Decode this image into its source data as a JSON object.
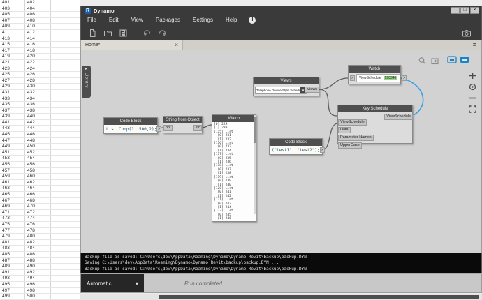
{
  "excel": {
    "rows": [
      [
        401,
        402
      ],
      [
        403,
        404
      ],
      [
        405,
        406
      ],
      [
        407,
        408
      ],
      [
        409,
        410
      ],
      [
        411,
        412
      ],
      [
        413,
        414
      ],
      [
        415,
        416
      ],
      [
        417,
        418
      ],
      [
        419,
        420
      ],
      [
        421,
        422
      ],
      [
        423,
        424
      ],
      [
        425,
        426
      ],
      [
        427,
        428
      ],
      [
        429,
        430
      ],
      [
        431,
        432
      ],
      [
        433,
        434
      ],
      [
        435,
        436
      ],
      [
        437,
        438
      ],
      [
        439,
        440
      ],
      [
        441,
        442
      ],
      [
        443,
        444
      ],
      [
        445,
        446
      ],
      [
        447,
        448
      ],
      [
        449,
        450
      ],
      [
        451,
        452
      ],
      [
        453,
        454
      ],
      [
        455,
        456
      ],
      [
        457,
        458
      ],
      [
        459,
        460
      ],
      [
        461,
        462
      ],
      [
        463,
        464
      ],
      [
        465,
        466
      ],
      [
        467,
        468
      ],
      [
        469,
        470
      ],
      [
        471,
        472
      ],
      [
        473,
        474
      ],
      [
        475,
        476
      ],
      [
        477,
        478
      ],
      [
        479,
        480
      ],
      [
        481,
        482
      ],
      [
        483,
        484
      ],
      [
        485,
        486
      ],
      [
        487,
        488
      ],
      [
        489,
        490
      ],
      [
        491,
        492
      ],
      [
        493,
        494
      ],
      [
        495,
        496
      ],
      [
        497,
        498
      ],
      [
        499,
        500
      ]
    ]
  },
  "window": {
    "title": "Dynamo",
    "logo": "R",
    "menus": [
      "File",
      "Edit",
      "View",
      "Packages",
      "Settings",
      "Help"
    ],
    "tab_label": "Home*"
  },
  "icons": {
    "minimize": "–",
    "maximize": "□",
    "close": "×",
    "hamburger": "≡",
    "caret_down": "▾",
    "notification": "!",
    "port_chevron": ">"
  },
  "sidebar": {
    "library_label": "Library"
  },
  "nodes": {
    "code_block_1": {
      "title": "Code Block",
      "code": "List.Chop(1..500,2);"
    },
    "string_from_object": {
      "title": "String from Object",
      "input": "obj",
      "output": "str"
    },
    "watch_list": {
      "title": "Watch",
      "lines": [
        "[0] 229",
        "[1] 230",
        "[115] List",
        "  [0] 231",
        "  [1] 232",
        "[116] List",
        "  [0] 233",
        "  [1] 234",
        "[117] List",
        "  [0] 235",
        "  [1] 236",
        "[118] List",
        "  [0] 237",
        "  [1] 238",
        "[119] List",
        "  [0] 239",
        "  [1] 240",
        "[120] List",
        "  [0] 241",
        "  [1] 242",
        "[121] List",
        "  [0] 243",
        "  [1] 244",
        "[122] List",
        "  [0] 245",
        "  [1] 246"
      ]
    },
    "views": {
      "title": "Views",
      "dropdown_value": "Telephone Device Style Schedule",
      "output": "Views"
    },
    "watch_schedule": {
      "title": "Watch",
      "type_label": "ViewSchedule",
      "value": "190346"
    },
    "key_schedule": {
      "title": "Key Schedule",
      "inputs": [
        "ViewSchedule",
        "Data",
        "Parameter Names",
        "UpperCase"
      ],
      "output": "ViewSchedule"
    },
    "code_block_2": {
      "title": "Code Block",
      "code": "(\"test1\", \"test2\");"
    }
  },
  "colors": {
    "wire_selected": "#35a0e8",
    "wire": "#5f5f5f",
    "value_highlight": "#9fd18f",
    "preview_toggle_blue": "#1e83c4"
  },
  "console": {
    "lines": [
      "Backup file is saved: C:\\Users\\dev\\AppData\\Roaming\\Dynamo\\Dynamo Revit\\backup\\backup.DYN",
      "Saving C:\\Users\\dev\\AppData\\Roaming\\Dynamo\\Dynamo Revit\\backup\\backup.DYN ...",
      "Backup file is saved: C:\\Users\\dev\\AppData\\Roaming\\Dynamo\\Dynamo Revit\\backup\\backup.DYN"
    ]
  },
  "run_bar": {
    "mode": "Automatic",
    "status": "Run completed."
  }
}
